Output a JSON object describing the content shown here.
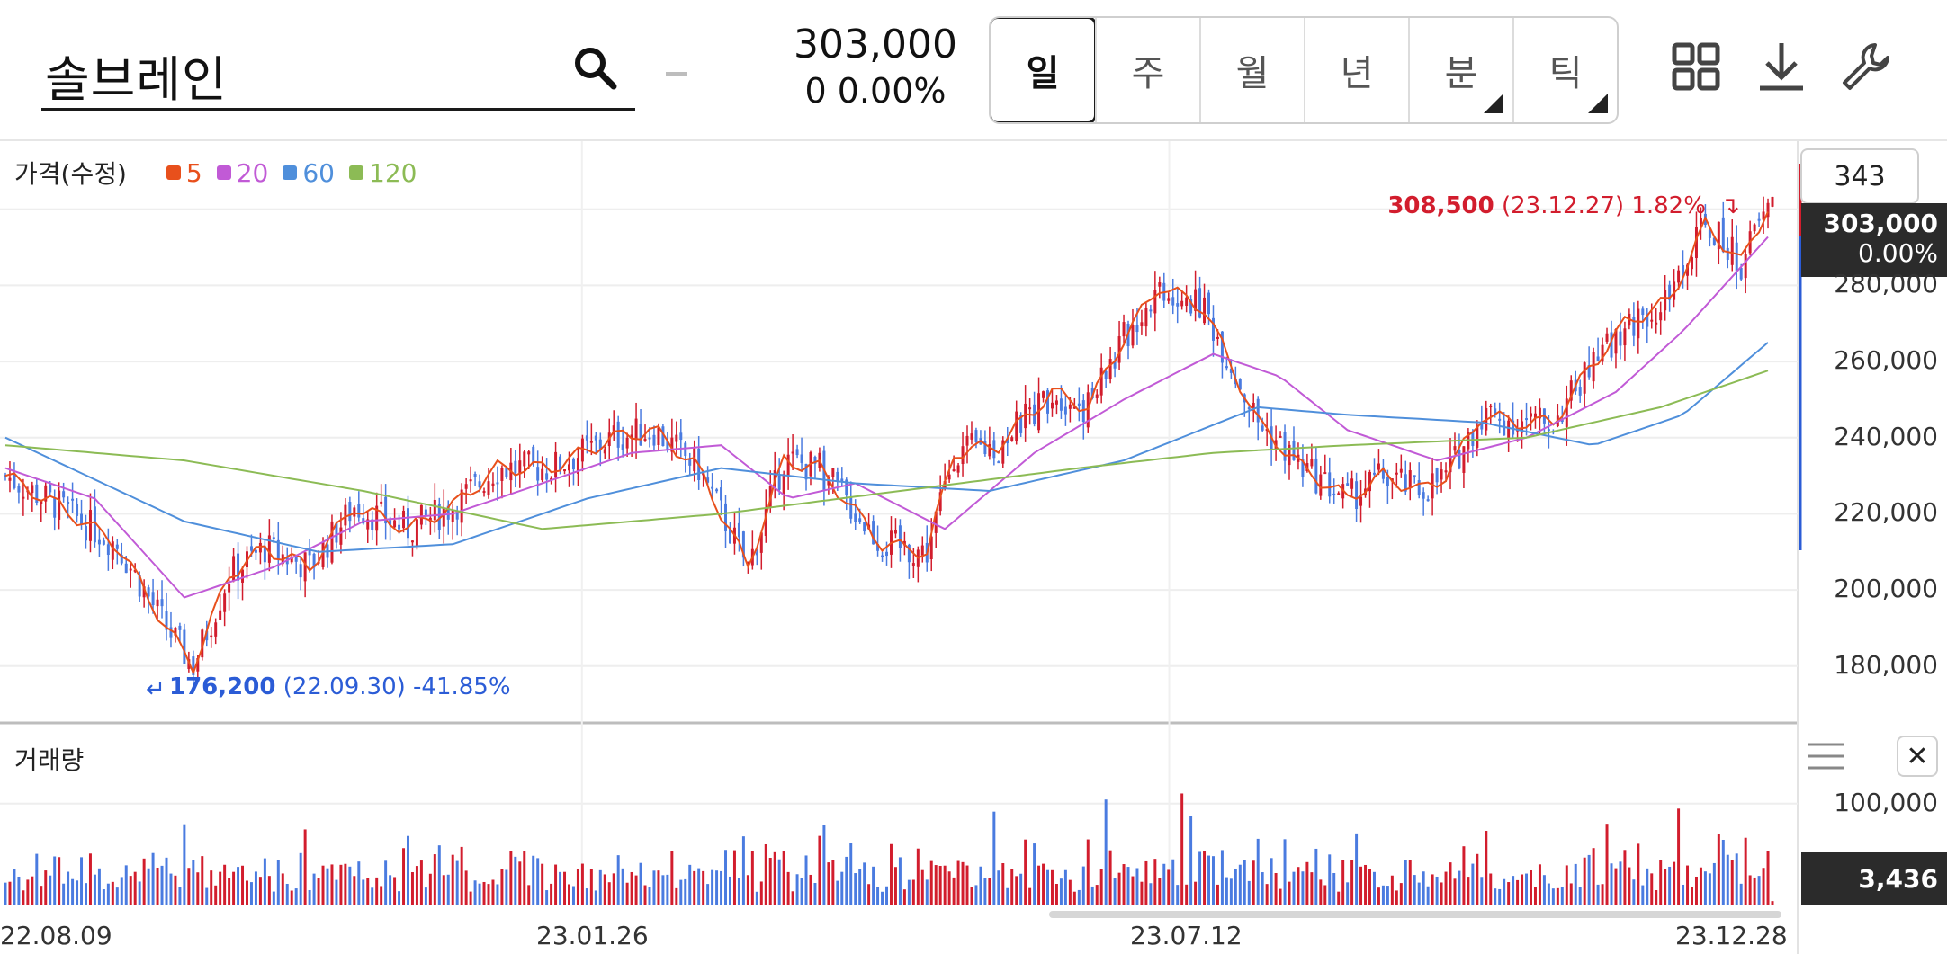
{
  "stock": {
    "name": "솔브레인",
    "price": "303,000",
    "change": "0  0.00%"
  },
  "period_tabs": [
    {
      "label": "일",
      "active": true,
      "submenu": false
    },
    {
      "label": "주",
      "active": false,
      "submenu": false
    },
    {
      "label": "월",
      "active": false,
      "submenu": false
    },
    {
      "label": "년",
      "active": false,
      "submenu": false
    },
    {
      "label": "분",
      "active": false,
      "submenu": true
    },
    {
      "label": "틱",
      "active": false,
      "submenu": true
    }
  ],
  "toolbar_icons": [
    "grid-layout-icon",
    "download-icon",
    "wrench-icon"
  ],
  "chart": {
    "price_title": "가격(수정)",
    "ma_legend": [
      {
        "label": "5",
        "color": "#e8501c"
      },
      {
        "label": "20",
        "color": "#c15ad6"
      },
      {
        "label": "60",
        "color": "#4f8fdb"
      },
      {
        "label": "120",
        "color": "#8cbb55"
      }
    ],
    "visible_count": "343",
    "current_price_tag": {
      "price": "303,000",
      "pct": "0.00%"
    },
    "high_annotation": {
      "value": "308,500",
      "detail": "(23.12.27) 1.82%"
    },
    "low_annotation": {
      "value": "176,200",
      "detail": "(22.09.30) -41.85%"
    },
    "volume_title": "거래량",
    "volume_tag": "3,436",
    "colors": {
      "up": "#d21d2d",
      "down": "#4a7be0",
      "ma5": "#e8501c",
      "ma20": "#c15ad6",
      "ma60": "#4f8fdb",
      "ma120": "#8cbb55"
    }
  },
  "chart_data": {
    "type": "candlestick",
    "price_axis_ticks": [
      "280,000",
      "260,000",
      "240,000",
      "220,000",
      "200,000",
      "180,000"
    ],
    "volume_axis_ticks": [
      "100,000"
    ],
    "x_ticks": [
      "22.08.09",
      "23.01.26",
      "23.07.12",
      "23.12.28"
    ],
    "ylim": [
      166000,
      316000
    ],
    "volume_ylim": [
      0,
      130000
    ],
    "price_anchors": [
      {
        "i": 0,
        "p": 230000
      },
      {
        "i": 12,
        "p": 222000
      },
      {
        "i": 25,
        "p": 212000
      },
      {
        "i": 36,
        "p": 190000
      },
      {
        "i": 42,
        "p": 180000
      },
      {
        "i": 50,
        "p": 204000
      },
      {
        "i": 58,
        "p": 211000
      },
      {
        "i": 68,
        "p": 206000
      },
      {
        "i": 78,
        "p": 222000
      },
      {
        "i": 90,
        "p": 216000
      },
      {
        "i": 100,
        "p": 222000
      },
      {
        "i": 110,
        "p": 232000
      },
      {
        "i": 122,
        "p": 232000
      },
      {
        "i": 136,
        "p": 240000
      },
      {
        "i": 145,
        "p": 242000
      },
      {
        "i": 155,
        "p": 232000
      },
      {
        "i": 166,
        "p": 206000
      },
      {
        "i": 174,
        "p": 234000
      },
      {
        "i": 182,
        "p": 232000
      },
      {
        "i": 196,
        "p": 212000
      },
      {
        "i": 206,
        "p": 210000
      },
      {
        "i": 212,
        "p": 236000
      },
      {
        "i": 222,
        "p": 238000
      },
      {
        "i": 234,
        "p": 252000
      },
      {
        "i": 242,
        "p": 248000
      },
      {
        "i": 250,
        "p": 266000
      },
      {
        "i": 258,
        "p": 280000
      },
      {
        "i": 268,
        "p": 274000
      },
      {
        "i": 280,
        "p": 244000
      },
      {
        "i": 290,
        "p": 232000
      },
      {
        "i": 300,
        "p": 224000
      },
      {
        "i": 308,
        "p": 230000
      },
      {
        "i": 316,
        "p": 226000
      },
      {
        "i": 322,
        "p": 230000
      },
      {
        "i": 330,
        "p": 246000
      },
      {
        "i": 338,
        "p": 244000
      },
      {
        "i": 346,
        "p": 244000
      },
      {
        "i": 354,
        "p": 258000
      },
      {
        "i": 362,
        "p": 270000
      },
      {
        "i": 372,
        "p": 276000
      },
      {
        "i": 380,
        "p": 296000
      },
      {
        "i": 388,
        "p": 286000
      },
      {
        "i": 395,
        "p": 303000
      }
    ],
    "ma_anchors": {
      "ma20": [
        {
          "i": 0,
          "p": 232000
        },
        {
          "i": 20,
          "p": 224000
        },
        {
          "i": 40,
          "p": 198000
        },
        {
          "i": 60,
          "p": 206000
        },
        {
          "i": 80,
          "p": 218000
        },
        {
          "i": 100,
          "p": 220000
        },
        {
          "i": 120,
          "p": 228000
        },
        {
          "i": 140,
          "p": 236000
        },
        {
          "i": 160,
          "p": 238000
        },
        {
          "i": 175,
          "p": 224000
        },
        {
          "i": 190,
          "p": 228000
        },
        {
          "i": 210,
          "p": 216000
        },
        {
          "i": 230,
          "p": 236000
        },
        {
          "i": 250,
          "p": 250000
        },
        {
          "i": 270,
          "p": 262000
        },
        {
          "i": 285,
          "p": 256000
        },
        {
          "i": 300,
          "p": 242000
        },
        {
          "i": 320,
          "p": 234000
        },
        {
          "i": 340,
          "p": 240000
        },
        {
          "i": 360,
          "p": 252000
        },
        {
          "i": 375,
          "p": 268000
        },
        {
          "i": 395,
          "p": 294000
        }
      ],
      "ma60": [
        {
          "i": 0,
          "p": 240000
        },
        {
          "i": 40,
          "p": 218000
        },
        {
          "i": 70,
          "p": 210000
        },
        {
          "i": 100,
          "p": 212000
        },
        {
          "i": 130,
          "p": 224000
        },
        {
          "i": 160,
          "p": 232000
        },
        {
          "i": 190,
          "p": 228000
        },
        {
          "i": 220,
          "p": 226000
        },
        {
          "i": 250,
          "p": 234000
        },
        {
          "i": 280,
          "p": 248000
        },
        {
          "i": 300,
          "p": 246000
        },
        {
          "i": 330,
          "p": 244000
        },
        {
          "i": 355,
          "p": 238000
        },
        {
          "i": 375,
          "p": 246000
        },
        {
          "i": 395,
          "p": 266000
        }
      ],
      "ma120": [
        {
          "i": 0,
          "p": 238000
        },
        {
          "i": 40,
          "p": 234000
        },
        {
          "i": 80,
          "p": 226000
        },
        {
          "i": 120,
          "p": 216000
        },
        {
          "i": 160,
          "p": 220000
        },
        {
          "i": 200,
          "p": 226000
        },
        {
          "i": 240,
          "p": 232000
        },
        {
          "i": 270,
          "p": 236000
        },
        {
          "i": 300,
          "p": 238000
        },
        {
          "i": 340,
          "p": 240000
        },
        {
          "i": 370,
          "p": 248000
        },
        {
          "i": 395,
          "p": 258000
        }
      ]
    },
    "volume_spikes": [
      {
        "i": 221,
        "v": 92000
      },
      {
        "i": 246,
        "v": 104000
      },
      {
        "i": 263,
        "v": 110000
      },
      {
        "i": 265,
        "v": 88000
      },
      {
        "i": 182,
        "v": 68000
      },
      {
        "i": 331,
        "v": 73000
      },
      {
        "i": 358,
        "v": 80000
      },
      {
        "i": 374,
        "v": 95000
      }
    ],
    "base_volume": 22000,
    "last_volume": 3436,
    "num_candles": 396
  }
}
